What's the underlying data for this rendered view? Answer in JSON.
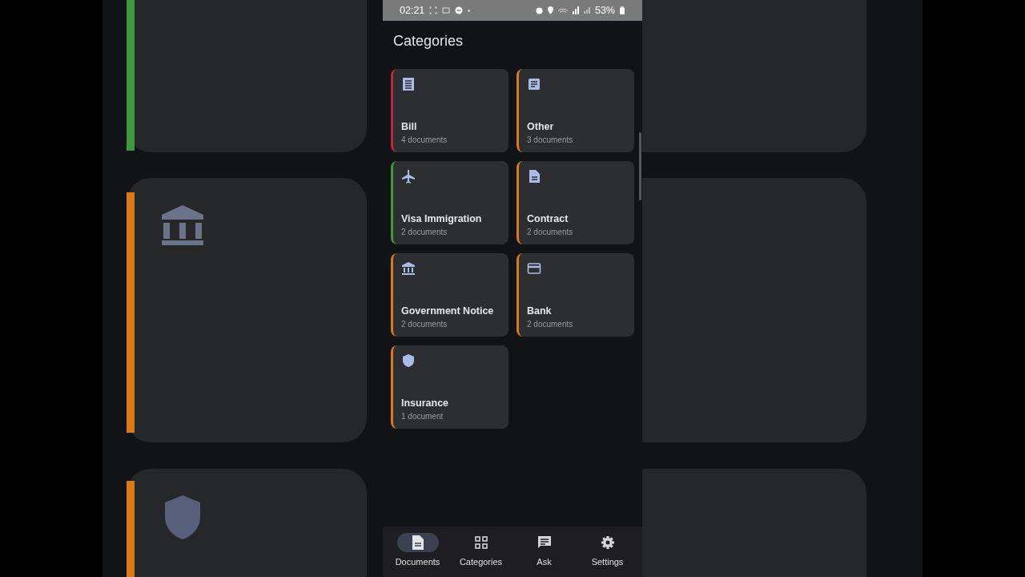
{
  "status_bar": {
    "time": "02:21",
    "battery": "53%"
  },
  "header": {
    "title": "Categories"
  },
  "categories": [
    {
      "name": "Bill",
      "count": "4 documents",
      "color": "#c0283a"
    },
    {
      "name": "Other",
      "count": "3 documents",
      "color": "#d87a1a"
    },
    {
      "name": "Visa Immigration",
      "count": "2 documents",
      "color": "#3f9a3f"
    },
    {
      "name": "Contract",
      "count": "2 documents",
      "color": "#d87a1a"
    },
    {
      "name": "Government Notice",
      "count": "2 documents",
      "color": "#d87a1a"
    },
    {
      "name": "Bank",
      "count": "2 documents",
      "color": "#d87a1a"
    },
    {
      "name": "Insurance",
      "count": "1 document",
      "color": "#d87a1a"
    }
  ],
  "nav": [
    {
      "label": "Documents",
      "selected": true
    },
    {
      "label": "Categories",
      "selected": false
    },
    {
      "label": "Ask",
      "selected": false
    },
    {
      "label": "Settings",
      "selected": false
    }
  ]
}
